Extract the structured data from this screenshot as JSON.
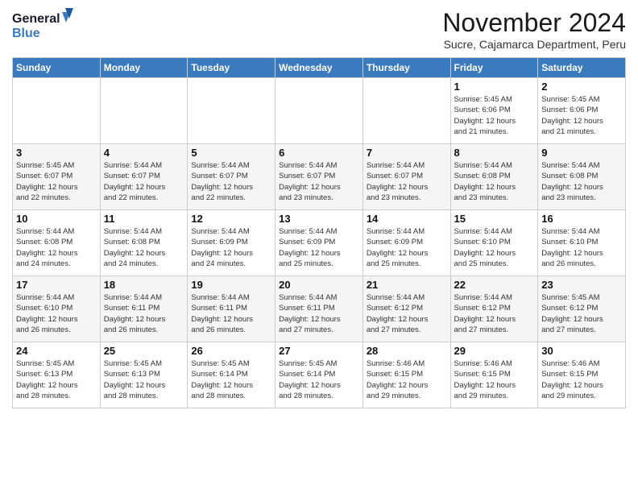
{
  "header": {
    "logo_line1": "General",
    "logo_line2": "Blue",
    "month_title": "November 2024",
    "subtitle": "Sucre, Cajamarca Department, Peru"
  },
  "days_of_week": [
    "Sunday",
    "Monday",
    "Tuesday",
    "Wednesday",
    "Thursday",
    "Friday",
    "Saturday"
  ],
  "weeks": [
    [
      {
        "day": "",
        "info": ""
      },
      {
        "day": "",
        "info": ""
      },
      {
        "day": "",
        "info": ""
      },
      {
        "day": "",
        "info": ""
      },
      {
        "day": "",
        "info": ""
      },
      {
        "day": "1",
        "info": "Sunrise: 5:45 AM\nSunset: 6:06 PM\nDaylight: 12 hours\nand 21 minutes."
      },
      {
        "day": "2",
        "info": "Sunrise: 5:45 AM\nSunset: 6:06 PM\nDaylight: 12 hours\nand 21 minutes."
      }
    ],
    [
      {
        "day": "3",
        "info": "Sunrise: 5:45 AM\nSunset: 6:07 PM\nDaylight: 12 hours\nand 22 minutes."
      },
      {
        "day": "4",
        "info": "Sunrise: 5:44 AM\nSunset: 6:07 PM\nDaylight: 12 hours\nand 22 minutes."
      },
      {
        "day": "5",
        "info": "Sunrise: 5:44 AM\nSunset: 6:07 PM\nDaylight: 12 hours\nand 22 minutes."
      },
      {
        "day": "6",
        "info": "Sunrise: 5:44 AM\nSunset: 6:07 PM\nDaylight: 12 hours\nand 23 minutes."
      },
      {
        "day": "7",
        "info": "Sunrise: 5:44 AM\nSunset: 6:07 PM\nDaylight: 12 hours\nand 23 minutes."
      },
      {
        "day": "8",
        "info": "Sunrise: 5:44 AM\nSunset: 6:08 PM\nDaylight: 12 hours\nand 23 minutes."
      },
      {
        "day": "9",
        "info": "Sunrise: 5:44 AM\nSunset: 6:08 PM\nDaylight: 12 hours\nand 23 minutes."
      }
    ],
    [
      {
        "day": "10",
        "info": "Sunrise: 5:44 AM\nSunset: 6:08 PM\nDaylight: 12 hours\nand 24 minutes."
      },
      {
        "day": "11",
        "info": "Sunrise: 5:44 AM\nSunset: 6:08 PM\nDaylight: 12 hours\nand 24 minutes."
      },
      {
        "day": "12",
        "info": "Sunrise: 5:44 AM\nSunset: 6:09 PM\nDaylight: 12 hours\nand 24 minutes."
      },
      {
        "day": "13",
        "info": "Sunrise: 5:44 AM\nSunset: 6:09 PM\nDaylight: 12 hours\nand 25 minutes."
      },
      {
        "day": "14",
        "info": "Sunrise: 5:44 AM\nSunset: 6:09 PM\nDaylight: 12 hours\nand 25 minutes."
      },
      {
        "day": "15",
        "info": "Sunrise: 5:44 AM\nSunset: 6:10 PM\nDaylight: 12 hours\nand 25 minutes."
      },
      {
        "day": "16",
        "info": "Sunrise: 5:44 AM\nSunset: 6:10 PM\nDaylight: 12 hours\nand 26 minutes."
      }
    ],
    [
      {
        "day": "17",
        "info": "Sunrise: 5:44 AM\nSunset: 6:10 PM\nDaylight: 12 hours\nand 26 minutes."
      },
      {
        "day": "18",
        "info": "Sunrise: 5:44 AM\nSunset: 6:11 PM\nDaylight: 12 hours\nand 26 minutes."
      },
      {
        "day": "19",
        "info": "Sunrise: 5:44 AM\nSunset: 6:11 PM\nDaylight: 12 hours\nand 26 minutes."
      },
      {
        "day": "20",
        "info": "Sunrise: 5:44 AM\nSunset: 6:11 PM\nDaylight: 12 hours\nand 27 minutes."
      },
      {
        "day": "21",
        "info": "Sunrise: 5:44 AM\nSunset: 6:12 PM\nDaylight: 12 hours\nand 27 minutes."
      },
      {
        "day": "22",
        "info": "Sunrise: 5:44 AM\nSunset: 6:12 PM\nDaylight: 12 hours\nand 27 minutes."
      },
      {
        "day": "23",
        "info": "Sunrise: 5:45 AM\nSunset: 6:12 PM\nDaylight: 12 hours\nand 27 minutes."
      }
    ],
    [
      {
        "day": "24",
        "info": "Sunrise: 5:45 AM\nSunset: 6:13 PM\nDaylight: 12 hours\nand 28 minutes."
      },
      {
        "day": "25",
        "info": "Sunrise: 5:45 AM\nSunset: 6:13 PM\nDaylight: 12 hours\nand 28 minutes."
      },
      {
        "day": "26",
        "info": "Sunrise: 5:45 AM\nSunset: 6:14 PM\nDaylight: 12 hours\nand 28 minutes."
      },
      {
        "day": "27",
        "info": "Sunrise: 5:45 AM\nSunset: 6:14 PM\nDaylight: 12 hours\nand 28 minutes."
      },
      {
        "day": "28",
        "info": "Sunrise: 5:46 AM\nSunset: 6:15 PM\nDaylight: 12 hours\nand 29 minutes."
      },
      {
        "day": "29",
        "info": "Sunrise: 5:46 AM\nSunset: 6:15 PM\nDaylight: 12 hours\nand 29 minutes."
      },
      {
        "day": "30",
        "info": "Sunrise: 5:46 AM\nSunset: 6:15 PM\nDaylight: 12 hours\nand 29 minutes."
      }
    ]
  ]
}
